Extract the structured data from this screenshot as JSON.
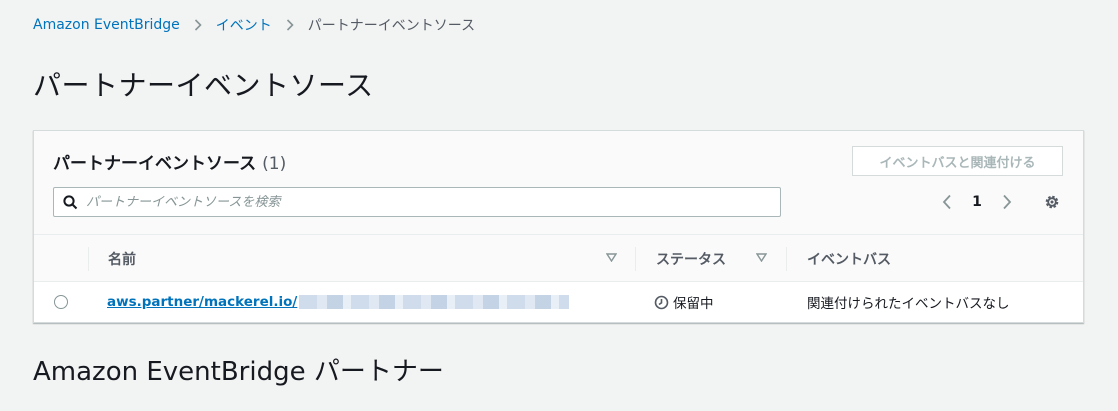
{
  "breadcrumb": {
    "items": [
      "Amazon EventBridge",
      "イベント"
    ],
    "current": "パートナーイベントソース"
  },
  "page_title": "パートナーイベントソース",
  "panel": {
    "title": "パートナーイベントソース",
    "count": "(1)",
    "associate_button": "イベントバスと関連付ける",
    "search_placeholder": "パートナーイベントソースを検索",
    "pagination": {
      "current_page": "1"
    },
    "columns": {
      "name": "名前",
      "status": "ステータス",
      "event_bus": "イベントバス"
    },
    "rows": [
      {
        "name": "aws.partner/mackerel.io/",
        "status": "保留中",
        "event_bus": "関連付けられたイベントバスなし"
      }
    ]
  },
  "section_title": "Amazon EventBridge パートナー",
  "icons": {
    "search": "search-icon",
    "chevron_left": "chevron-left-icon",
    "chevron_right": "chevron-right-icon",
    "settings": "gear-icon",
    "sort": "sort-down-icon",
    "status": "clock-icon"
  },
  "colors": {
    "link": "#0073bb",
    "background": "#f2f3f3",
    "disabled": "#aab7b8"
  }
}
